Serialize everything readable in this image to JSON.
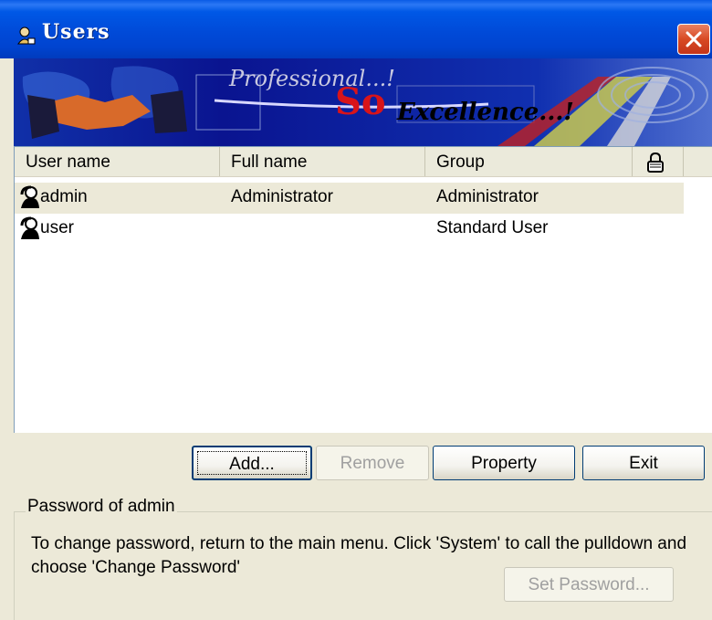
{
  "window": {
    "title": "Users",
    "close_icon": "close-icon"
  },
  "banner": {
    "text_professional": "Professional...!",
    "text_so": "So",
    "text_excellence": "Excellence...!"
  },
  "list": {
    "columns": [
      "User name",
      "Full name",
      "Group"
    ],
    "lock_icon": "lock-icon",
    "rows": [
      {
        "user": "admin",
        "full_name": "Administrator",
        "group": "Administrator",
        "selected": true
      },
      {
        "user": "user",
        "full_name": "",
        "group": "Standard User",
        "selected": false
      }
    ]
  },
  "buttons": {
    "add": "Add...",
    "remove": "Remove",
    "property": "Property",
    "exit": "Exit",
    "set_password": "Set Password..."
  },
  "password_group": {
    "label": "Password of admin",
    "help": "To change password, return to the main menu. Click 'System' to call the pulldown and choose 'Change Password'"
  },
  "colors": {
    "titlebar": "#0054e3",
    "window_bg": "#ece9d8",
    "close": "#d84a23",
    "banner": "#0a0f8c"
  }
}
